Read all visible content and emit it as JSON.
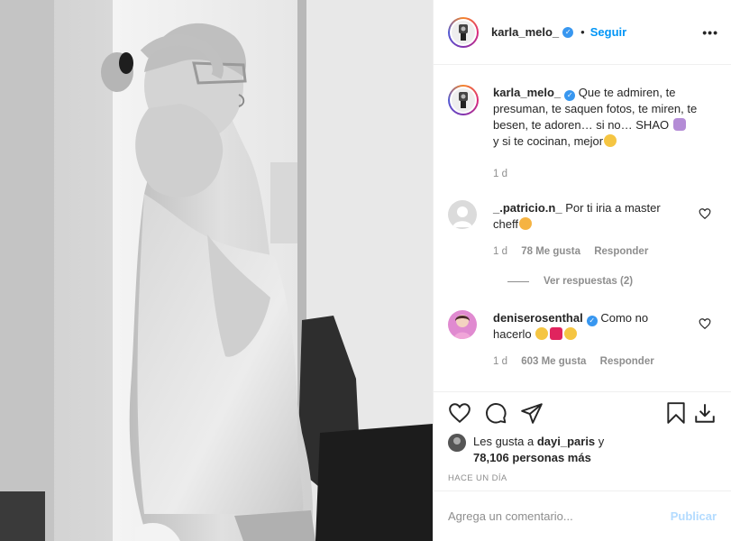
{
  "post": {
    "author": "karla_melo_",
    "follow_label": "Seguir",
    "dot": "•",
    "more": "•••"
  },
  "caption": {
    "username": "karla_melo_",
    "text": "Que te admiren, te presuman, te saquen fotos, te miren, te besen, te adoren… si no… SHAO",
    "text_tail": "y si te cocinan, mejor",
    "time": "1 d"
  },
  "comments": [
    {
      "username": "_.patricio.n_",
      "text": "Por ti iria a master cheff",
      "time": "1 d",
      "likes": "78 Me gusta",
      "reply_label": "Responder",
      "view_replies": "Ver respuestas (2)"
    },
    {
      "username": "deniserosenthal",
      "text": "Como no hacerlo",
      "time": "1 d",
      "likes": "603 Me gusta",
      "reply_label": "Responder"
    }
  ],
  "likes": {
    "prefix": "Les gusta a",
    "user": "dayi_paris",
    "mid": "y",
    "count": "78,106 personas más"
  },
  "ago": "HACE UN DÍA",
  "comment_box": {
    "placeholder": "Agrega un comentario...",
    "publish_label": "Publicar"
  },
  "icons": {
    "like": "heart-icon",
    "comment": "comment-icon",
    "share": "paper-plane-icon",
    "save": "bookmark-icon",
    "download": "download-icon"
  },
  "colors": {
    "link_blue": "#0095f6",
    "verified_blue": "#3897f0",
    "muted": "#8e8e8e",
    "publish_disabled": "#b3dbff"
  }
}
